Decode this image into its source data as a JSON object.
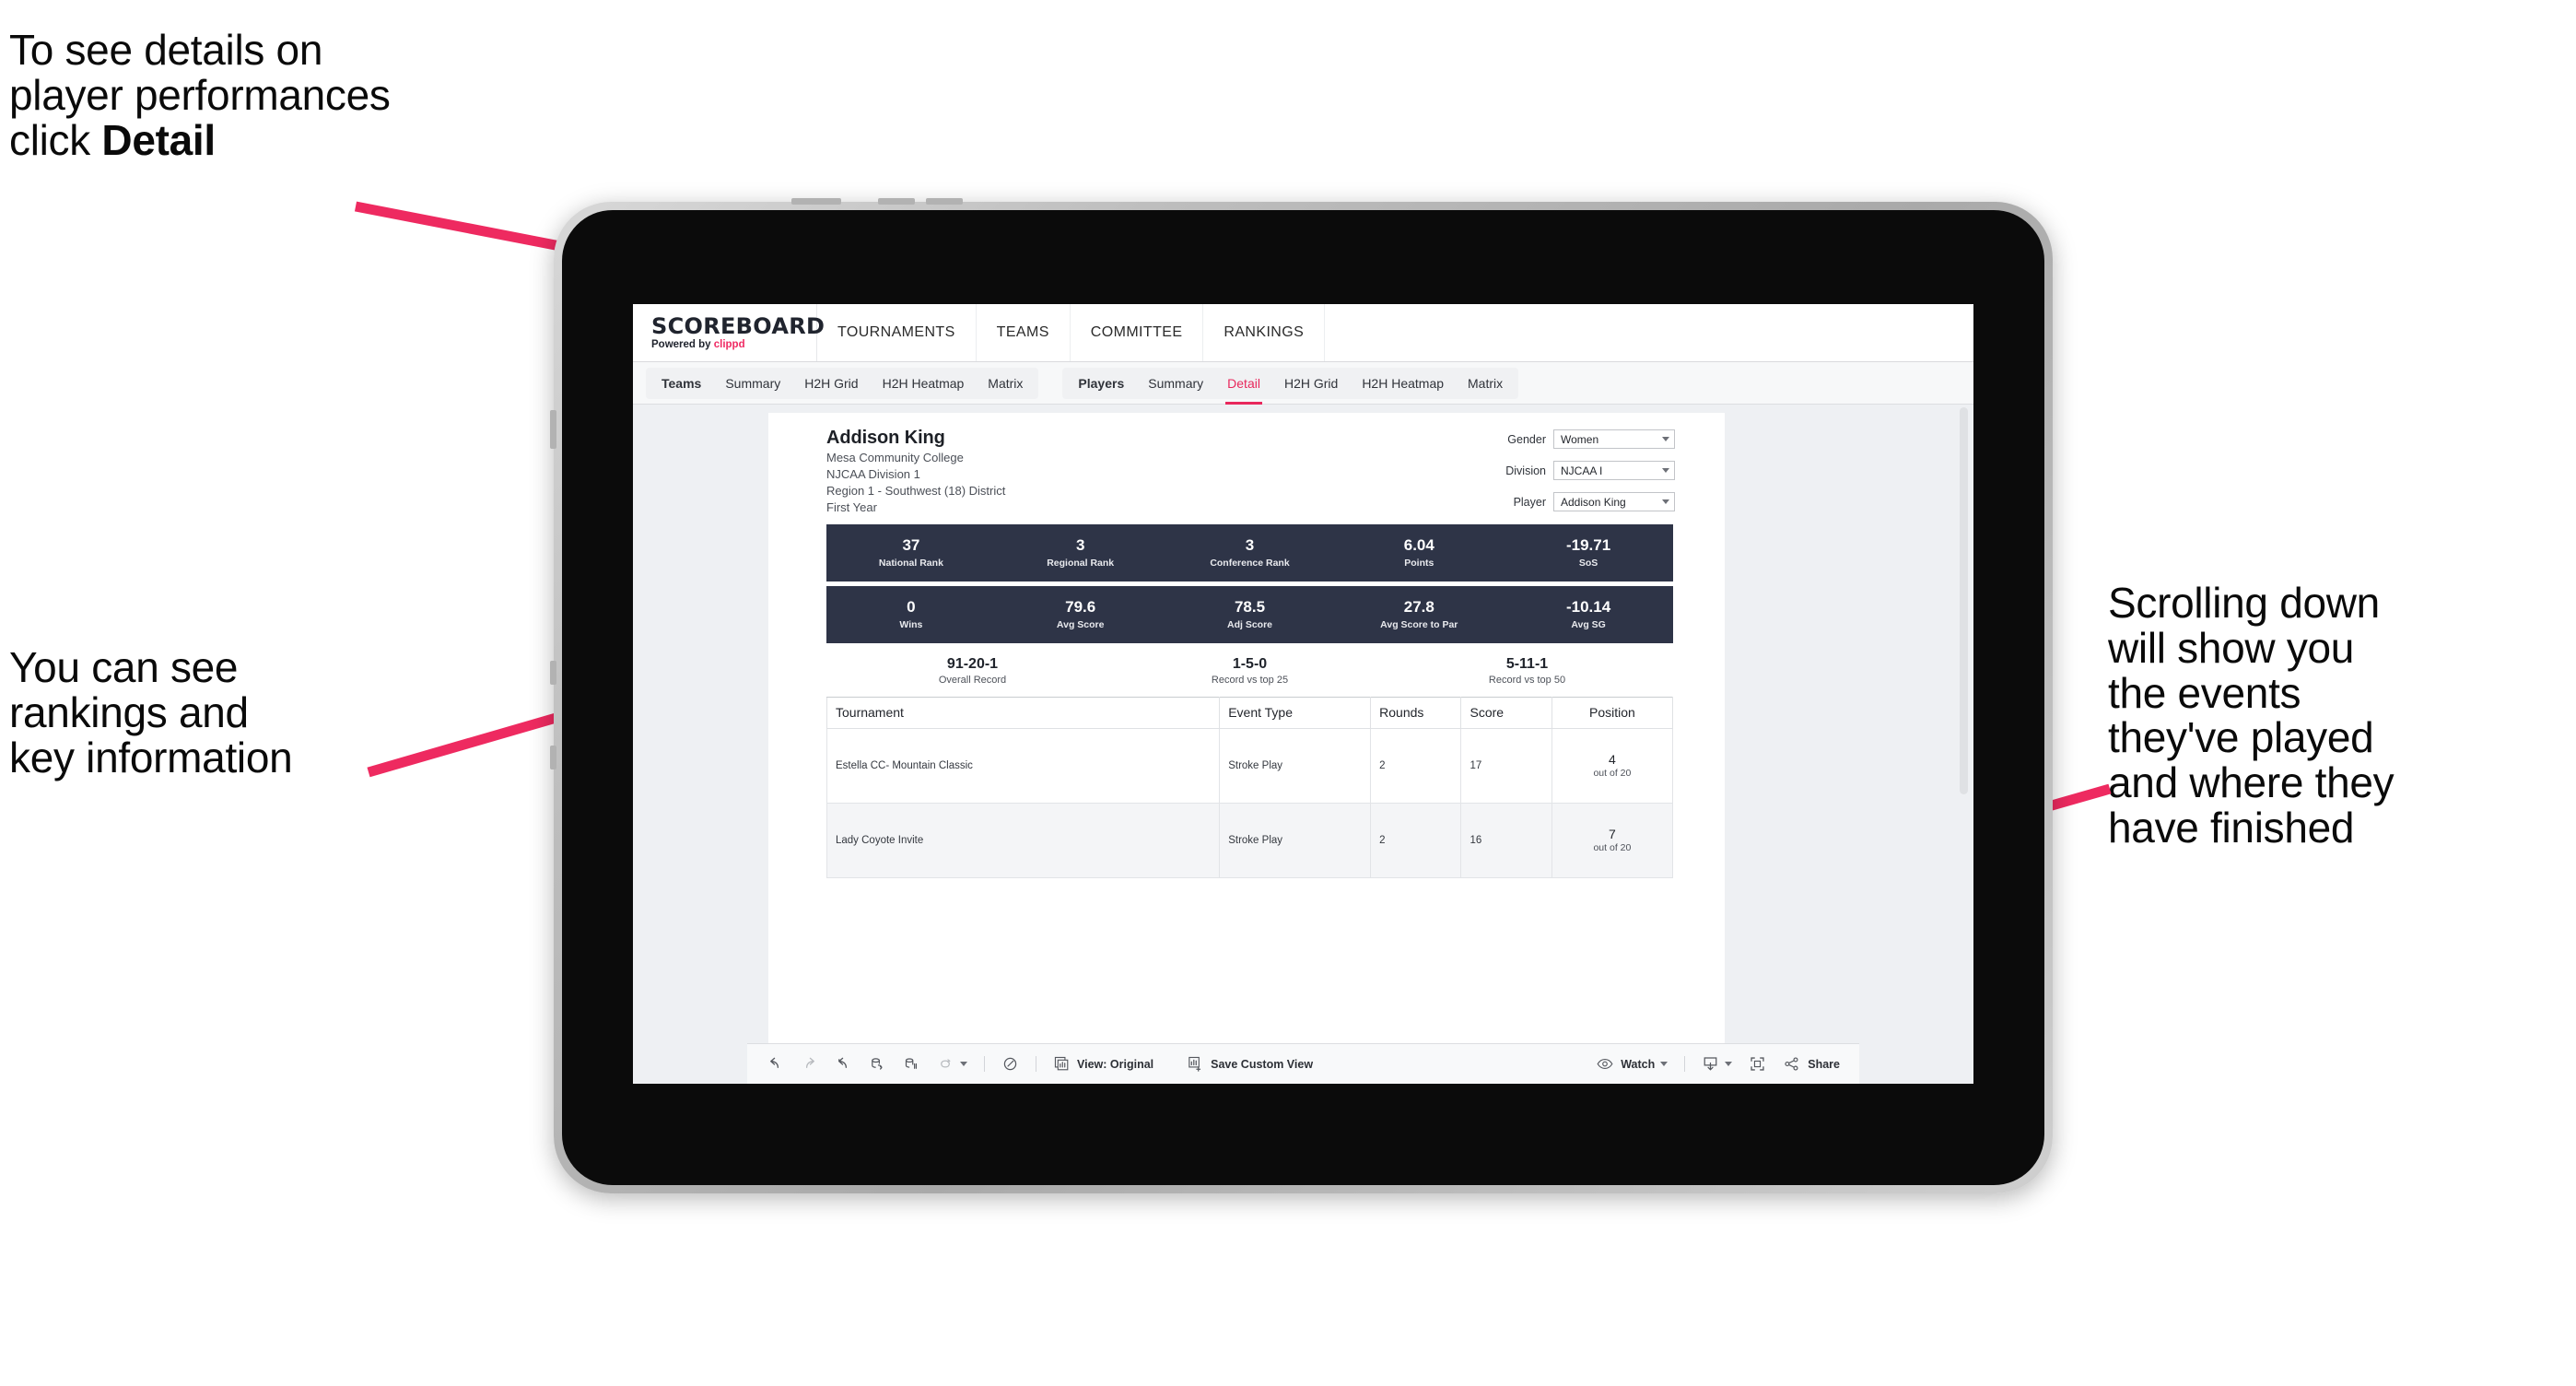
{
  "annotations": {
    "top_left": "To see details on\nplayer performances\nclick ",
    "top_left_bold": "Detail",
    "mid_left": "You can see\nrankings and\nkey information",
    "right": "Scrolling down\nwill show you\nthe events\nthey've played\nand where they\nhave finished",
    "arrow_color": "#ee2a60"
  },
  "app": {
    "brand": {
      "title": "SCOREBOARD",
      "powered_prefix": "Powered by ",
      "powered_brand": "clippd"
    },
    "top_nav": [
      "TOURNAMENTS",
      "TEAMS",
      "COMMITTEE",
      "RANKINGS"
    ],
    "tab_groups": [
      {
        "head": "Teams",
        "tabs": [
          "Summary",
          "H2H Grid",
          "H2H Heatmap",
          "Matrix"
        ],
        "active": null
      },
      {
        "head": "Players",
        "tabs": [
          "Summary",
          "Detail",
          "H2H Grid",
          "H2H Heatmap",
          "Matrix"
        ],
        "active": "Detail"
      }
    ]
  },
  "player": {
    "name": "Addison King",
    "school": "Mesa Community College",
    "division": "NJCAA Division 1",
    "region": "Region 1 - Southwest (18) District",
    "year": "First Year"
  },
  "filters": [
    {
      "label": "Gender",
      "value": "Women"
    },
    {
      "label": "Division",
      "value": "NJCAA I"
    },
    {
      "label": "Player",
      "value": "Addison King"
    }
  ],
  "stats_row_1": [
    {
      "value": "37",
      "label": "National Rank"
    },
    {
      "value": "3",
      "label": "Regional Rank"
    },
    {
      "value": "3",
      "label": "Conference Rank"
    },
    {
      "value": "6.04",
      "label": "Points"
    },
    {
      "value": "-19.71",
      "label": "SoS"
    }
  ],
  "stats_row_2": [
    {
      "value": "0",
      "label": "Wins"
    },
    {
      "value": "79.6",
      "label": "Avg Score"
    },
    {
      "value": "78.5",
      "label": "Adj Score"
    },
    {
      "value": "27.8",
      "label": "Avg Score to Par"
    },
    {
      "value": "-10.14",
      "label": "Avg SG"
    }
  ],
  "records": [
    {
      "value": "91-20-1",
      "label": "Overall Record"
    },
    {
      "value": "1-5-0",
      "label": "Record vs top 25"
    },
    {
      "value": "5-11-1",
      "label": "Record vs top 50"
    }
  ],
  "tournament_table": {
    "headers": [
      "Tournament",
      "Event Type",
      "Rounds",
      "Score",
      "Position"
    ],
    "rows": [
      {
        "tournament": "Estella CC- Mountain Classic",
        "event_type": "Stroke Play",
        "rounds": "2",
        "score": "17",
        "position": "4",
        "position_sub": "out of 20"
      },
      {
        "tournament": "Lady Coyote Invite",
        "event_type": "Stroke Play",
        "rounds": "2",
        "score": "16",
        "position": "7",
        "position_sub": "out of 20"
      }
    ]
  },
  "toolbar": {
    "view_label": "View: Original",
    "save_label": "Save Custom View",
    "watch_label": "Watch",
    "share_label": "Share"
  },
  "colors": {
    "accent_pink": "#e8285c",
    "navy": "#2e3447",
    "canvas": "#eef0f3"
  }
}
